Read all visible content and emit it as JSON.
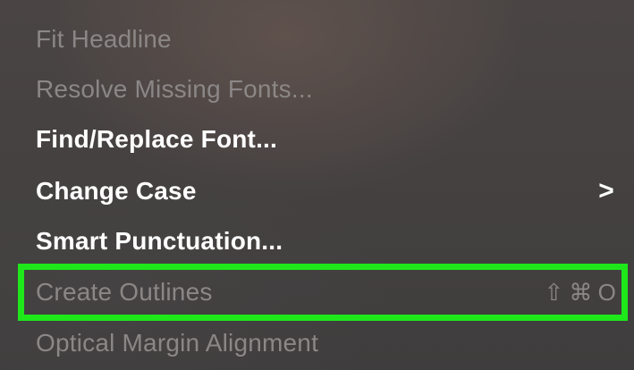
{
  "menu": {
    "items": [
      {
        "label": "Fit Headline",
        "enabled": false
      },
      {
        "label": "Resolve Missing Fonts...",
        "enabled": false
      },
      {
        "label": "Find/Replace Font...",
        "enabled": true
      },
      {
        "label": "Change Case",
        "enabled": true,
        "submenu_indicator": ">"
      },
      {
        "label": "Smart Punctuation...",
        "enabled": true
      },
      {
        "label": "Create Outlines",
        "enabled": false,
        "shortcut": {
          "shift": "⇧",
          "command": "⌘",
          "key": "O"
        }
      },
      {
        "label": "Optical Margin Alignment",
        "enabled": false
      }
    ]
  },
  "highlight": {
    "target": "Create Outlines",
    "color": "#1ee81a"
  },
  "colors": {
    "enabled_text": "#ffffff",
    "disabled_text": "#8b8786",
    "background": "#454141"
  }
}
